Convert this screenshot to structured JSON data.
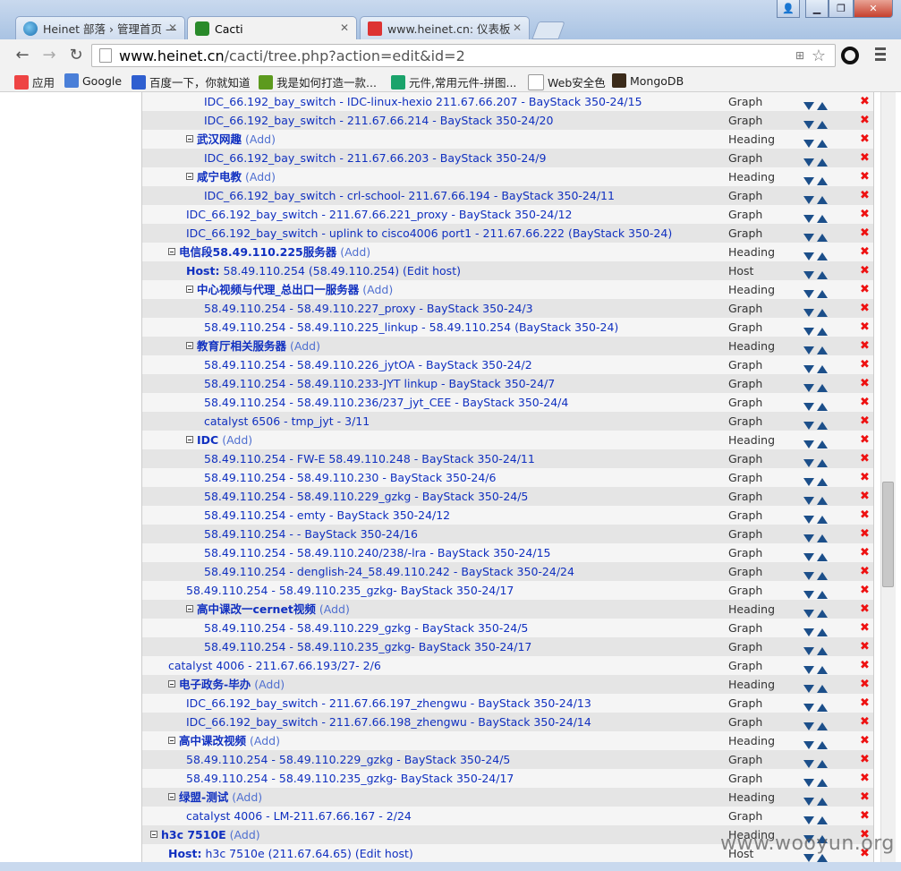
{
  "browser": {
    "tabs": [
      {
        "title": "Heinet 部落 › 管理首页 —",
        "active": false,
        "icon": "heinet-icon"
      },
      {
        "title": "Cacti",
        "active": true,
        "icon": "cacti-icon"
      },
      {
        "title": "www.heinet.cn: 仪表板",
        "active": false,
        "icon": "mail-icon"
      }
    ],
    "url_host": "www.heinet.cn",
    "url_path": "/cacti/tree.php?action=edit&id=2",
    "bookmarks": [
      {
        "label": "应用",
        "icon": "apps-icon",
        "color": "#e44"
      },
      {
        "label": "Google",
        "icon": "google-icon",
        "color": "#4a7fd8"
      },
      {
        "label": "百度一下，你就知道",
        "icon": "baidu-icon",
        "color": "#2f5fd0"
      },
      {
        "label": "我是如何打造一款...",
        "icon": "bookmark-f-icon",
        "color": "#5c9a1e"
      },
      {
        "label": "元件,常用元件-拼图...",
        "icon": "pintu-icon",
        "color": "#1aa36b"
      },
      {
        "label": "Web安全色",
        "icon": "page-icon",
        "color": "#ffffff"
      },
      {
        "label": "MongoDB",
        "icon": "mongodb-icon",
        "color": "#3b2b1a"
      }
    ]
  },
  "tree": {
    "add_label": "(Add)",
    "rows": [
      {
        "indent": 3,
        "text": "IDC_66.192_bay_switch - IDC-linux-hexio 211.67.66.207 - BayStack 350-24/15",
        "type": "Graph"
      },
      {
        "indent": 3,
        "text": "IDC_66.192_bay_switch - 211.67.66.214 - BayStack 350-24/20",
        "type": "Graph"
      },
      {
        "indent": 2,
        "heading": true,
        "text": "武汉网趣",
        "type": "Heading"
      },
      {
        "indent": 3,
        "text": "IDC_66.192_bay_switch - 211.67.66.203 - BayStack 350-24/9",
        "type": "Graph"
      },
      {
        "indent": 2,
        "heading": true,
        "text": "咸宁电教",
        "type": "Heading"
      },
      {
        "indent": 3,
        "text": "IDC_66.192_bay_switch - crl-school- 211.67.66.194 - BayStack 350-24/11",
        "type": "Graph"
      },
      {
        "indent": 2,
        "text": "IDC_66.192_bay_switch - 211.67.66.221_proxy - BayStack 350-24/12",
        "type": "Graph"
      },
      {
        "indent": 2,
        "text": "IDC_66.192_bay_switch - uplink to cisco4006 port1 - 211.67.66.222 (BayStack 350-24)",
        "type": "Graph"
      },
      {
        "indent": 1,
        "heading": true,
        "text": "电信段58.49.110.225服务器",
        "type": "Heading"
      },
      {
        "indent": 2,
        "host": true,
        "host_label": "Host:",
        "text": "58.49.110.254 (58.49.110.254) (Edit host)",
        "type": "Host"
      },
      {
        "indent": 2,
        "heading": true,
        "text": "中心视频与代理_总出口一服务器",
        "type": "Heading"
      },
      {
        "indent": 3,
        "text": "58.49.110.254 - 58.49.110.227_proxy - BayStack 350-24/3",
        "type": "Graph"
      },
      {
        "indent": 3,
        "text": "58.49.110.254 - 58.49.110.225_linkup - 58.49.110.254 (BayStack 350-24)",
        "type": "Graph"
      },
      {
        "indent": 2,
        "heading": true,
        "text": "教育厅相关服务器",
        "type": "Heading"
      },
      {
        "indent": 3,
        "text": "58.49.110.254 - 58.49.110.226_jytOA - BayStack 350-24/2",
        "type": "Graph"
      },
      {
        "indent": 3,
        "text": "58.49.110.254 - 58.49.110.233-JYT linkup - BayStack 350-24/7",
        "type": "Graph"
      },
      {
        "indent": 3,
        "text": "58.49.110.254 - 58.49.110.236/237_jyt_CEE - BayStack 350-24/4",
        "type": "Graph"
      },
      {
        "indent": 3,
        "text": "catalyst 6506 - tmp_jyt - 3/11",
        "type": "Graph"
      },
      {
        "indent": 2,
        "heading": true,
        "text": "IDC",
        "type": "Heading"
      },
      {
        "indent": 3,
        "text": "58.49.110.254 - FW-E 58.49.110.248 - BayStack 350-24/11",
        "type": "Graph"
      },
      {
        "indent": 3,
        "text": "58.49.110.254 - 58.49.110.230 - BayStack 350-24/6",
        "type": "Graph"
      },
      {
        "indent": 3,
        "text": "58.49.110.254 - 58.49.110.229_gzkg - BayStack 350-24/5",
        "type": "Graph"
      },
      {
        "indent": 3,
        "text": "58.49.110.254 - emty - BayStack 350-24/12",
        "type": "Graph"
      },
      {
        "indent": 3,
        "text": "58.49.110.254 - - BayStack 350-24/16",
        "type": "Graph"
      },
      {
        "indent": 3,
        "text": "58.49.110.254 - 58.49.110.240/238/-lra - BayStack 350-24/15",
        "type": "Graph"
      },
      {
        "indent": 3,
        "text": "58.49.110.254 - denglish-24_58.49.110.242 - BayStack 350-24/24",
        "type": "Graph"
      },
      {
        "indent": 2,
        "text": "58.49.110.254 - 58.49.110.235_gzkg- BayStack 350-24/17",
        "type": "Graph"
      },
      {
        "indent": 2,
        "heading": true,
        "text": "高中课改一cernet视频",
        "type": "Heading"
      },
      {
        "indent": 3,
        "text": "58.49.110.254 - 58.49.110.229_gzkg - BayStack 350-24/5",
        "type": "Graph"
      },
      {
        "indent": 3,
        "text": "58.49.110.254 - 58.49.110.235_gzkg- BayStack 350-24/17",
        "type": "Graph"
      },
      {
        "indent": 1,
        "text": "catalyst 4006 - 211.67.66.193/27- 2/6",
        "type": "Graph"
      },
      {
        "indent": 1,
        "heading": true,
        "text": "电子政务-毕办",
        "type": "Heading"
      },
      {
        "indent": 2,
        "text": "IDC_66.192_bay_switch - 211.67.66.197_zhengwu - BayStack 350-24/13",
        "type": "Graph"
      },
      {
        "indent": 2,
        "text": "IDC_66.192_bay_switch - 211.67.66.198_zhengwu - BayStack 350-24/14",
        "type": "Graph"
      },
      {
        "indent": 1,
        "heading": true,
        "text": "高中课改视频",
        "type": "Heading"
      },
      {
        "indent": 2,
        "text": "58.49.110.254 - 58.49.110.229_gzkg - BayStack 350-24/5",
        "type": "Graph"
      },
      {
        "indent": 2,
        "text": "58.49.110.254 - 58.49.110.235_gzkg- BayStack 350-24/17",
        "type": "Graph"
      },
      {
        "indent": 1,
        "heading": true,
        "text": "绿盟-测试",
        "type": "Heading"
      },
      {
        "indent": 2,
        "text": "catalyst 4006 - LM-211.67.66.167 - 2/24",
        "type": "Graph"
      },
      {
        "indent": 0,
        "heading": true,
        "text": "h3c 7510E",
        "type": "Heading"
      },
      {
        "indent": 1,
        "host": true,
        "host_label": "Host:",
        "text": "h3c 7510e (211.67.64.65) (Edit host)",
        "type": "Host"
      }
    ]
  },
  "watermark": "www.wooyun.org"
}
